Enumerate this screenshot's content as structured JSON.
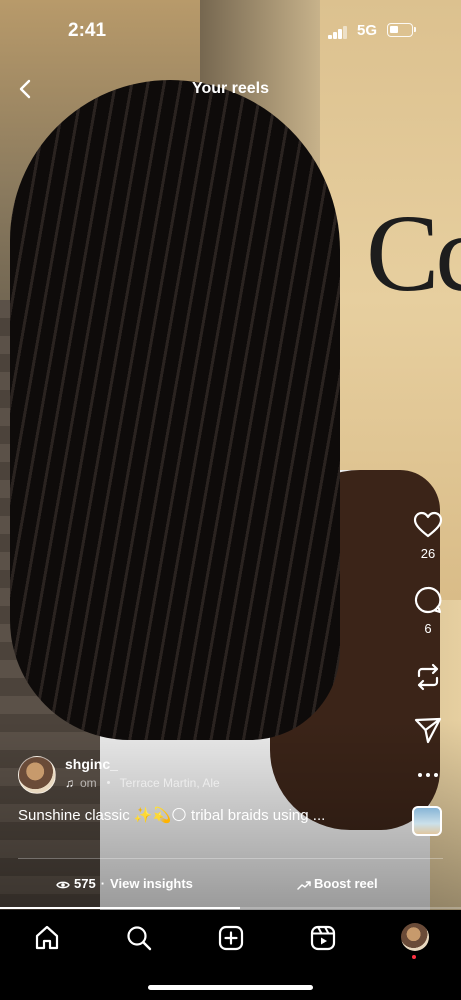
{
  "status_bar": {
    "time": "2:41",
    "network": "5G",
    "icons": [
      "signal-icon",
      "battery-icon"
    ]
  },
  "header": {
    "title": "Your reels",
    "back_icon": "back-chevron-icon"
  },
  "actions": {
    "likes": {
      "icon": "heart-icon",
      "count": "26"
    },
    "comments": {
      "icon": "comment-icon",
      "count": "6"
    },
    "remix_icon": "remix-icon",
    "share_icon": "send-icon",
    "more_icon": "more-icon"
  },
  "post": {
    "username": "shginc_",
    "audio": {
      "prefix": "om",
      "track": "Terrace Martin, Ale"
    },
    "caption": "Sunshine classic ✨💫🌕 tribal braids using ...",
    "views": "575",
    "insights_label": "View insights",
    "boost_label": "Boost reel",
    "progress": 0.52
  },
  "nav": {
    "items": [
      "home-icon",
      "search-icon",
      "create-icon",
      "reels-icon",
      "profile-avatar"
    ]
  },
  "colors": {
    "accent_red": "#ff3040",
    "text": "#ffffff",
    "background": "#000000"
  }
}
